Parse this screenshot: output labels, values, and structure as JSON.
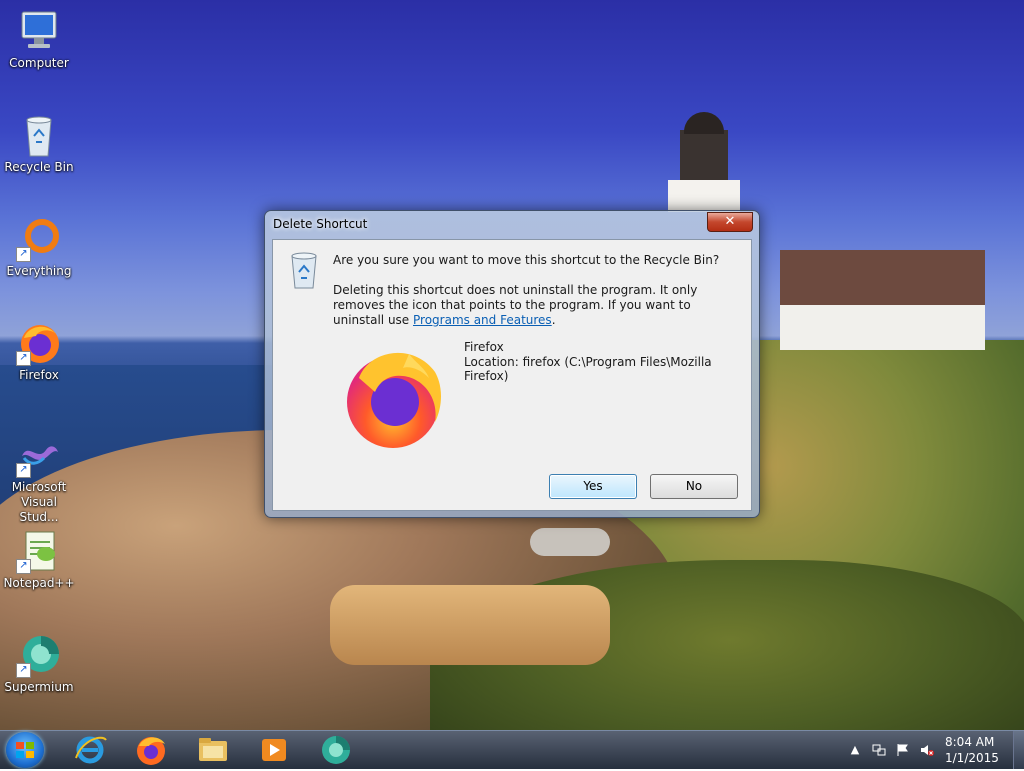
{
  "desktop": {
    "icons": [
      {
        "label": "Computer",
        "icon": "computer-icon"
      },
      {
        "label": "Recycle Bin",
        "icon": "recycle-bin-icon"
      },
      {
        "label": "Everything",
        "icon": "everything-icon"
      },
      {
        "label": "Firefox",
        "icon": "firefox-icon"
      },
      {
        "label": "Microsoft Visual Stud...",
        "icon": "visual-studio-icon"
      },
      {
        "label": "Notepad++",
        "icon": "notepadpp-icon"
      },
      {
        "label": "Supermium",
        "icon": "supermium-icon"
      }
    ]
  },
  "dialog": {
    "title": "Delete Shortcut",
    "close_label": "✕",
    "question": "Are you sure you want to move this shortcut to the Recycle Bin?",
    "explanation": "Deleting this shortcut does not uninstall the program. It only removes the icon that points to the program. If you want to uninstall use ",
    "link_text": "Programs and Features",
    "explanation_end": ".",
    "item_name": "Firefox",
    "item_location": "Location: firefox (C:\\Program Files\\Mozilla Firefox)",
    "yes_label": "Yes",
    "no_label": "No"
  },
  "taskbar": {
    "pinned": [
      "internet-explorer-icon",
      "firefox-icon",
      "file-explorer-icon",
      "media-player-icon",
      "supermium-icon"
    ],
    "time": "8:04 AM",
    "date": "1/1/2015"
  },
  "colors": {
    "link": "#0a5fb4",
    "close_button": "#c4472d",
    "default_button_border": "#3c7fb1"
  }
}
